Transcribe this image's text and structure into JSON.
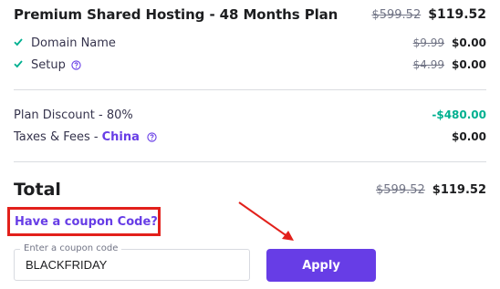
{
  "plan": {
    "title": "Premium Shared Hosting - 48 Months Plan",
    "old_price": "$599.52",
    "new_price": "$119.52"
  },
  "features": [
    {
      "label": "Domain Name",
      "old_price": "$9.99",
      "new_price": "$0.00",
      "icon": "check-icon"
    },
    {
      "label": "Setup",
      "old_price": "$4.99",
      "new_price": "$0.00",
      "icon": "check-icon",
      "help": "help-circle-icon"
    }
  ],
  "adjustments": {
    "discount": {
      "label": "Plan Discount - 80%",
      "value": "-$480.00"
    },
    "taxes": {
      "label": "Taxes & Fees -",
      "country": "China",
      "value": "$0.00",
      "help": "help-circle-icon"
    }
  },
  "total": {
    "label": "Total",
    "old_price": "$599.52",
    "new_price": "$119.52"
  },
  "coupon": {
    "link_label": "Have a coupon Code?",
    "field_legend": "Enter a coupon code",
    "field_value": "BLACKFRIDAY",
    "apply_label": "Apply"
  },
  "colors": {
    "accent": "#673de6",
    "success": "#00b090",
    "highlight_box": "#e2201b",
    "arrow": "#e2201b"
  }
}
